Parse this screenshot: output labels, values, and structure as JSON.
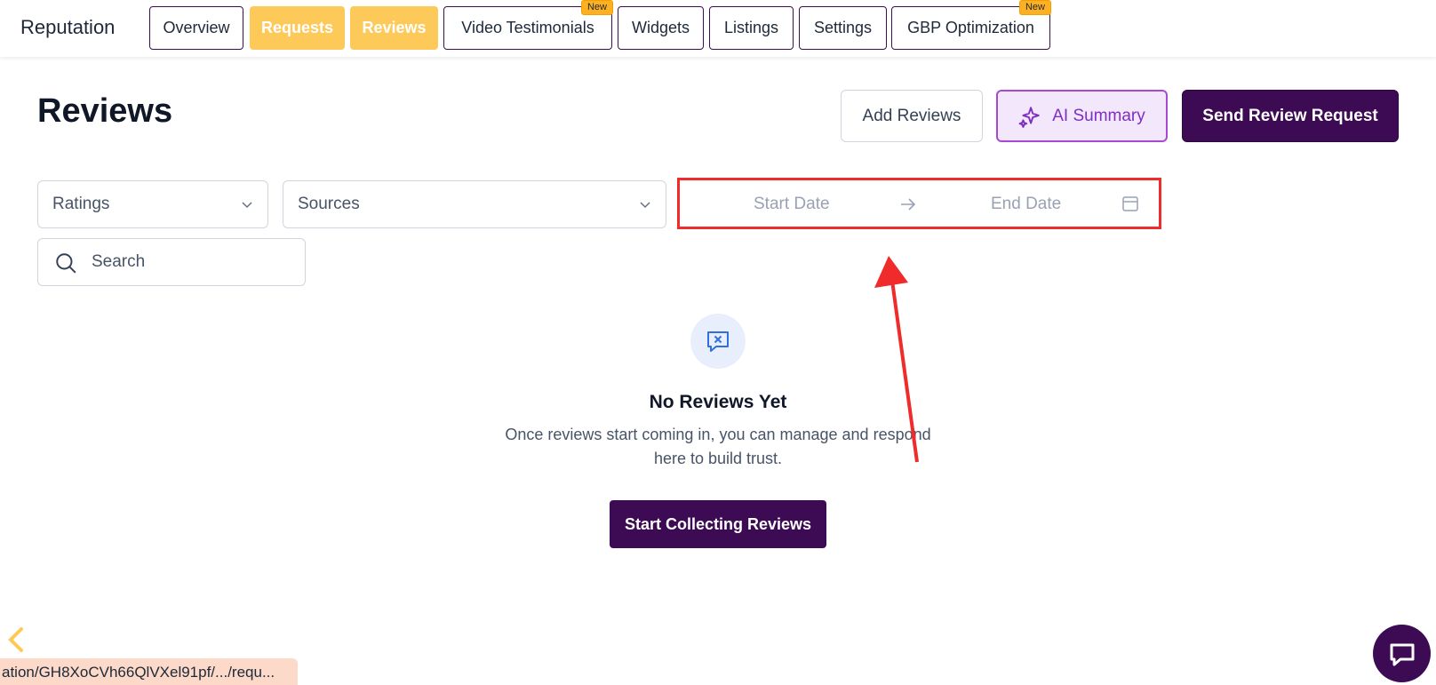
{
  "app": {
    "title": "Reputation"
  },
  "nav": {
    "tabs": [
      {
        "label": "Overview",
        "badge": ""
      },
      {
        "label": "Requests",
        "badge": ""
      },
      {
        "label": "Reviews",
        "badge": ""
      },
      {
        "label": "Video Testimonials",
        "badge": "New"
      },
      {
        "label": "Widgets",
        "badge": ""
      },
      {
        "label": "Listings",
        "badge": ""
      },
      {
        "label": "Settings",
        "badge": ""
      },
      {
        "label": "GBP Optimization",
        "badge": "New"
      }
    ]
  },
  "header": {
    "title": "Reviews",
    "add_reviews_label": "Add Reviews",
    "ai_summary_label": "AI Summary",
    "send_request_label": "Send Review Request"
  },
  "filters": {
    "ratings": {
      "value": "Ratings"
    },
    "sources": {
      "value": "Sources"
    },
    "date_range": {
      "start_placeholder": "Start Date",
      "end_placeholder": "End Date"
    },
    "search": {
      "placeholder": "Search"
    }
  },
  "empty_state": {
    "title": "No Reviews Yet",
    "description": "Once reviews start coming in, you can manage and respond here to build trust.",
    "cta_label": "Start Collecting Reviews"
  },
  "status_bar": {
    "url": "ation/GH8XoCVh66QlVXel91pf/.../requ..."
  },
  "colors": {
    "primary": "#3d0a54",
    "accent_yellow": "#fdc959",
    "ai_purple": "#7f2ec3",
    "annotation_red": "#ef2b2b"
  },
  "icons": {
    "ai_summary": "sparkle-icon",
    "empty_state": "chat-x-icon",
    "calendar": "calendar-icon",
    "search": "search-icon",
    "chat": "chat-bubble-icon"
  }
}
